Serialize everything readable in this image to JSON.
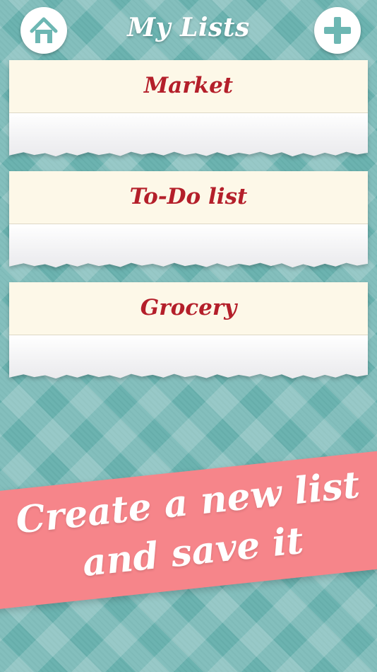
{
  "header": {
    "title": "My Lists",
    "home_icon": "home-icon",
    "add_icon": "plus-icon"
  },
  "lists": [
    {
      "title": "Market"
    },
    {
      "title": "To-Do list"
    },
    {
      "title": "Grocery"
    }
  ],
  "promo": {
    "line1": "Create a new list",
    "line2": "and save it"
  },
  "colors": {
    "background": "#6cb3b0",
    "title_red": "#b41f2a",
    "card_header": "#fdf8e8",
    "banner_pink": "#f6858a",
    "button_icon_teal": "#6db7b3"
  }
}
